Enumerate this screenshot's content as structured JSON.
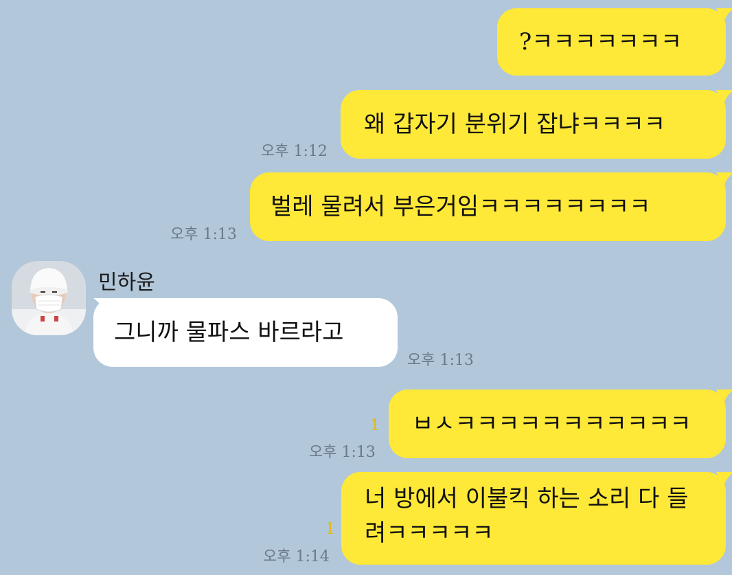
{
  "chat": {
    "messages": [
      {
        "id": "m1",
        "from": "me",
        "text": "?ㅋㅋㅋㅋㅋㅋㅋ",
        "time": "",
        "unread": ""
      },
      {
        "id": "m2",
        "from": "me",
        "text": "왜 갑자기 분위기 잡냐ㅋㅋㅋㅋ",
        "time": "오후 1:12",
        "unread": ""
      },
      {
        "id": "m3",
        "from": "me",
        "text": "벌레 물려서 부은거임ㅋㅋㅋㅋㅋㅋㅋㅋ",
        "time": "오후 1:13",
        "unread": ""
      },
      {
        "id": "m4",
        "from": "other",
        "sender": "민하윤",
        "text": "그니까 물파스 바르라고",
        "time": "오후 1:13",
        "unread": ""
      },
      {
        "id": "m5",
        "from": "me",
        "text": "ㅂㅅㅋㅋㅋㅋㅋㅋㅋㅋㅋㅋㅋ",
        "time": "오후 1:13",
        "unread": "1"
      },
      {
        "id": "m6",
        "from": "me",
        "text": "너 방에서 이불킥 하는 소리 다 들려ㅋㅋㅋㅋㅋ",
        "time": "오후 1:14",
        "unread": "1"
      }
    ]
  },
  "colors": {
    "background": "#b2c7da",
    "my_bubble": "#fee838",
    "other_bubble": "#ffffff",
    "timestamp": "#6b7888",
    "unread": "#d9b823"
  },
  "icons": {
    "avatar": "profile-photo-person-in-mask-and-white-beanie"
  }
}
